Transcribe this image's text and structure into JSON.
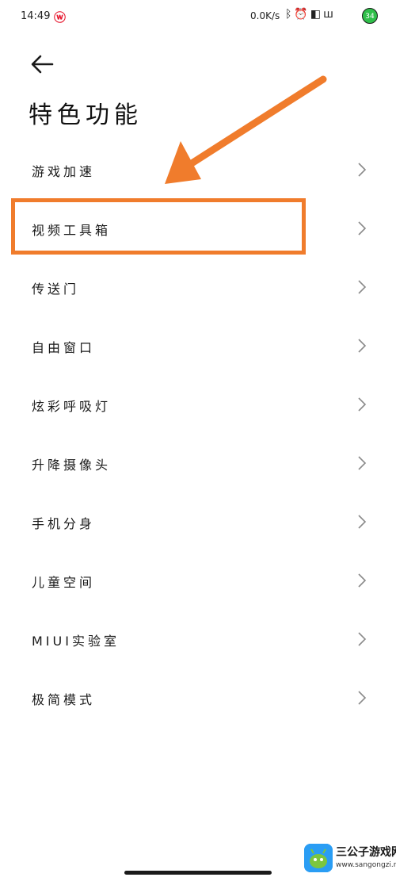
{
  "status_bar": {
    "time": "14:49",
    "network_speed": "0.0K/s",
    "battery": "34"
  },
  "header": {
    "title": "特色功能"
  },
  "menu": {
    "items": [
      {
        "label": "游戏加速"
      },
      {
        "label": "视频工具箱"
      },
      {
        "label": "传送门"
      },
      {
        "label": "自由窗口"
      },
      {
        "label": "炫彩呼吸灯"
      },
      {
        "label": "升降摄像头"
      },
      {
        "label": "手机分身"
      },
      {
        "label": "儿童空间"
      },
      {
        "label": "MIUI实验室"
      },
      {
        "label": "极简模式"
      }
    ]
  },
  "annotation": {
    "highlighted_item": "视频工具箱",
    "color": "#f07c2c"
  },
  "watermark": {
    "title": "三公子游戏网",
    "url": "www.sangongzi.net"
  }
}
